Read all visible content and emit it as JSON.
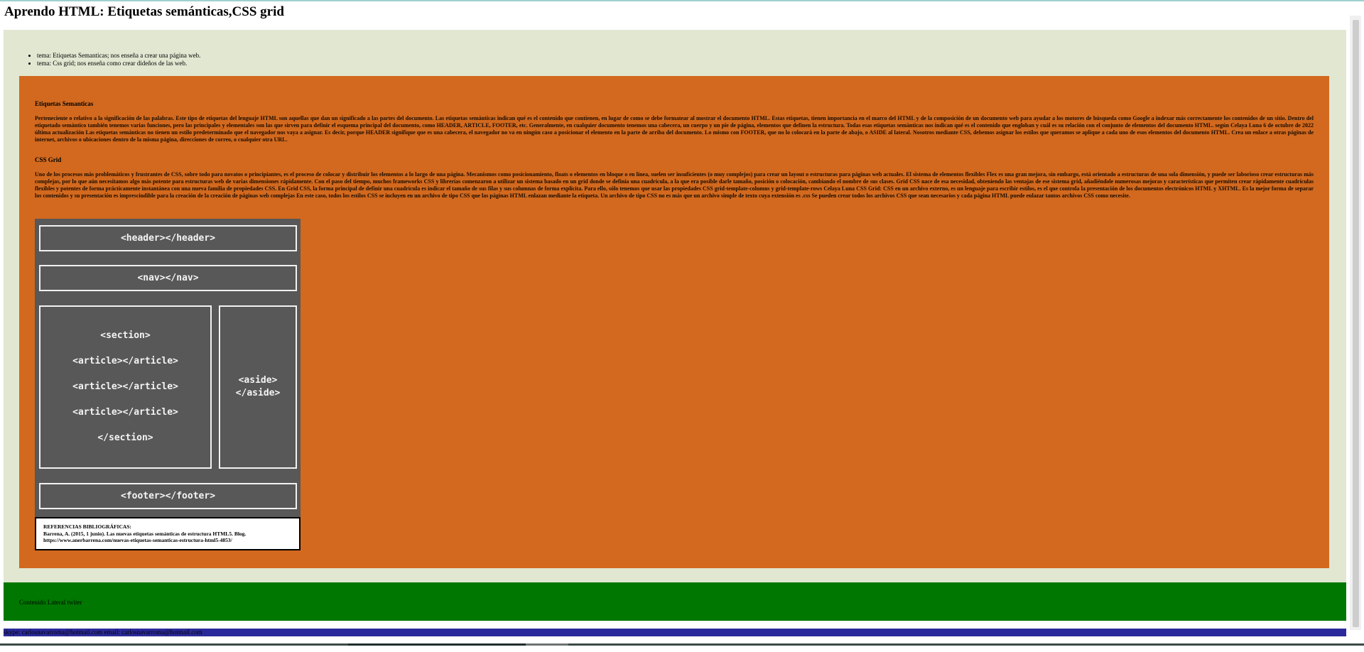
{
  "page": {
    "title": "Aprendo HTML: Etiquetas semánticas,CSS grid"
  },
  "topics": [
    "tema: Etiquetas Semanticas; nos enseña a crear una página web.",
    "tema: Css grid; nos enseña como crear dideños de las web."
  ],
  "sections": [
    {
      "title": "Etiquetas Semanticas",
      "text": "Perteneciente o relativo a la significación de las palabras. Este tipo de etiquetas del lenguaje HTML son aquellas que dan un significado a las partes del documento. Las etiquetas semánticas indican qué es el contenido que contienen, en lugar de como se debe formatear al mostrar el documento HTML. Estas etiquetas, tienen importancia en el marco del HTML y de la composición de un documento web para ayudar a los motores de búsqueda como Google a indexar más correctamente los contenidos de un sitio. Dentro del etiquetado semántico también tenemos varias funciones, pero las principales y elementales son las que sirven para definir el esquema principal del documento, como HEADER, ARTICLE, FOOTER, etc. Generalmente, en cualquier documento tenemos una cabecera, un cuerpo y un pie de página, elementos que definen la estructura. Todas esas etiquetas semánticas nos indican qué es el contenido que engloban y cuál es su relación con el conjunto de elementos del documento HTML. según Celaya Luna 6 de octubre de 2022 última actualización Las etiquetas semánticas no tienen un estilo predeterminado que el navegador nos vaya a asignar. Es decir, porque HEADER signifique que es una cabecera, el navegador no va en ningún caso a posicionar el elemento en la parte de arriba del documento. Lo mismo con FOOTER, que no lo colocará en la parte de abajo, o ASIDE al lateral. Nosotros mediante CSS, debemos asignar los estilos que queramos se aplique a cada uno de esos elementos del documento HTML. Crea un enlace a otras páginas de internet, archivos o ubicaciones dentro de la misma página, direcciones de correo, o cualquier otra URL."
    },
    {
      "title": "CSS Grid",
      "text": "Uno de los procesos más problemáticos y frustrantes de CSS, sobre todo para novatos o principiantes, es el proceso de colocar y distribuir los elementos a lo largo de una página. Mecanismos como posicionamiento, floats o elementos en bloque o en línea, suelen ser insuficientes (o muy complejos) para crear un layout o estructuras para páginas web actuales. El sistema de elementos flexibles Flex es una gran mejora, sin embargo, está orientado a estructuras de una sola dimensión, y puede ser laborioso crear estructuras más complejas, por lo que aún necesitamos algo más potente para estructuras web de varias dimensiones rápidamente. Con el paso del tiempo, muchos frameworks CSS y librerías comenzaron a utilizar un sistema basado en un grid donde se definía una cuadrícula, a la que era posible darle tamaño, posición o colocación, cambiando el nombre de sus clases. Grid CSS nace de esa necesidad, obteniendo las ventajas de ese sistema grid, añadiéndole numerosas mejoras y características que permiten crear rápidamente cuadrículas flexibles y potentes de forma prácticamente instantánea con una nueva familia de propiedades CSS. En Grid CSS, la forma principal de definir una cuadrícula es indicar el tamaño de sus filas y sus columnas de forma explícita. Para ello, sólo tenemos que usar las propiedades CSS grid-template-columns y grid-template-rows Celaya Luna CSS Grid: CSS en un archivo externo, es un lenguaje para escribir estilos, es el que controla la presentación de los documentos electrónicos HTML y XHTML. Es la mejor forma de separar los contenidos y su presentación es imprescindible para la creación de la creación de páginas web complejas En este caso, todos los estilos CSS se incluyen en un archivo de tipo CSS que las páginas HTML enlazan mediante la etiqueta. Un archivo de tipo CSS no es más que un archivo simple de texto cuya extensión es .css Se pueden crear todos los archivos CSS que sean necesarios y cada página HTML puede enlazar tantos archivos CSS como necesite."
    }
  ],
  "diagram": {
    "header": "<header></header>",
    "nav": "<nav></nav>",
    "section_lines": [
      "<section>",
      "<article></article>",
      "<article></article>",
      "<article></article>",
      "</section>"
    ],
    "aside_lines": [
      "<aside>",
      "</aside>"
    ],
    "footer": "<footer></footer>"
  },
  "references": {
    "heading": "REFERENCIAS BIBLIOGRÁFICAS:",
    "citation": "Barrena, A. (2015, 1 junio). Las nuevas etiquetas semánticas de estructura HTML5. Blog.",
    "url": "https://www.anerbarrena.com/nuevas-etiquetas-semanticas-estructura-html5-4853/"
  },
  "lateral": {
    "text": "Contenido Lateral twiter"
  },
  "footer": {
    "text": "skype: carlosnavarroma@hotmail.com email: carlosnavarroma@hotmail.com"
  },
  "colors": {
    "outer_bg": "#e1e7d1",
    "main_bg": "#d2691e",
    "diagram_bg": "#585858",
    "lateral_bg": "#007700",
    "footer_bg": "#2c2a9a"
  }
}
